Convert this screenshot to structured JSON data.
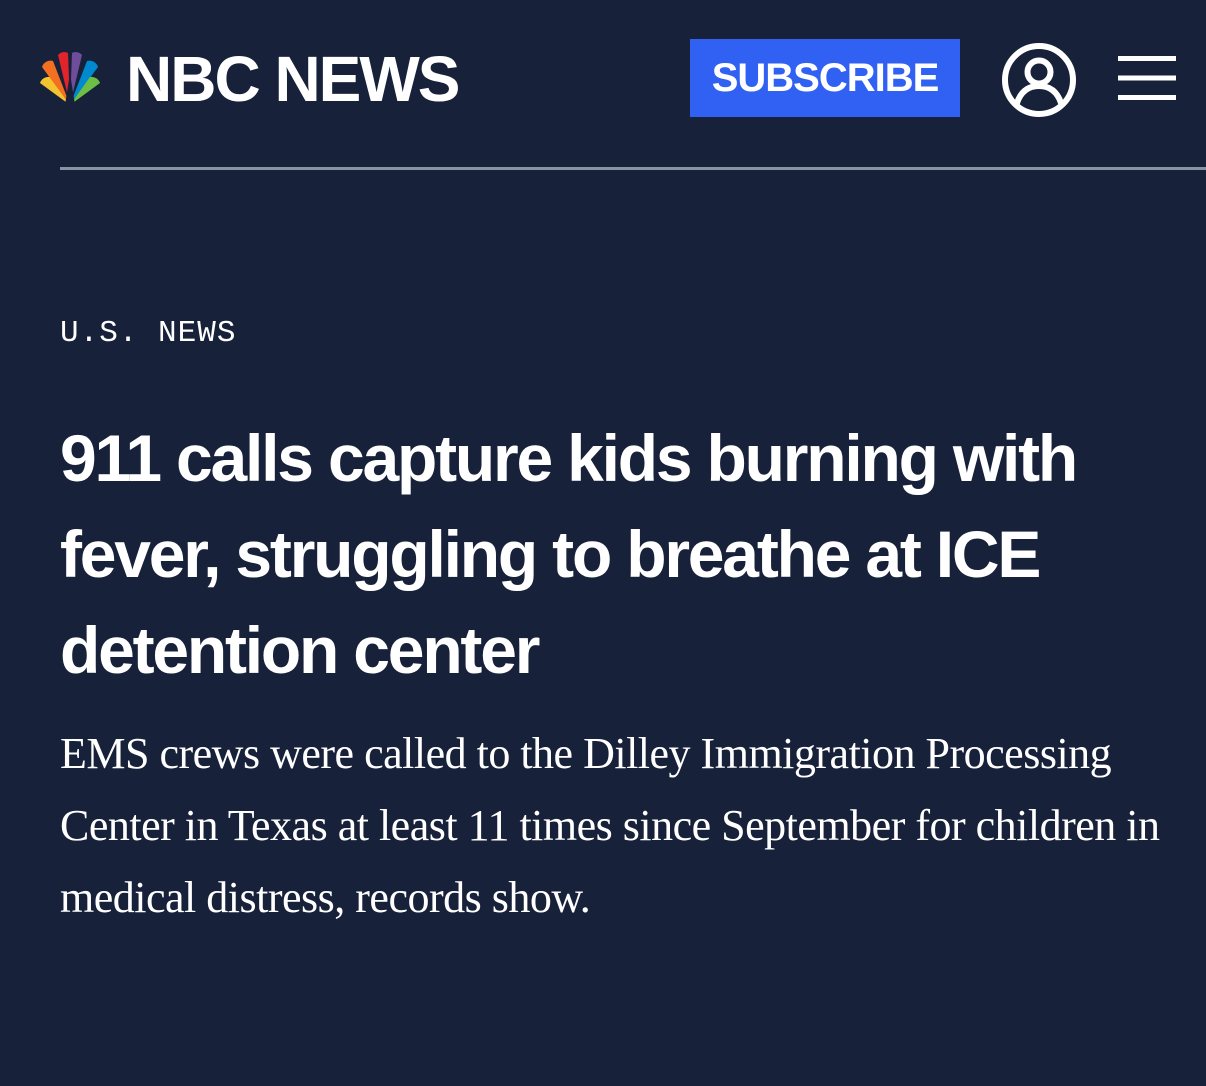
{
  "header": {
    "brand_name": "NBC NEWS",
    "subscribe_label": "SUBSCRIBE",
    "logo_icon": "nbc-peacock-icon",
    "account_icon": "user-account-icon",
    "menu_icon": "hamburger-menu-icon"
  },
  "article": {
    "section": "U.S. NEWS",
    "headline": "911 calls capture kids burning with fever, struggling to breathe at ICE detention center",
    "dek": "EMS crews were called to the Dilley Immigration Processing Center in Texas at least 11 times since September for children in medical distress, records show."
  },
  "colors": {
    "background": "#18213a",
    "subscribe_button": "#3061f2",
    "divider": "#8b92a3",
    "text": "#ffffff",
    "peacock_yellow": "#f4c430",
    "peacock_orange": "#f37021",
    "peacock_red": "#e1242c",
    "peacock_purple": "#6e4d9b",
    "peacock_blue": "#0089cf",
    "peacock_green": "#6cbe45"
  }
}
